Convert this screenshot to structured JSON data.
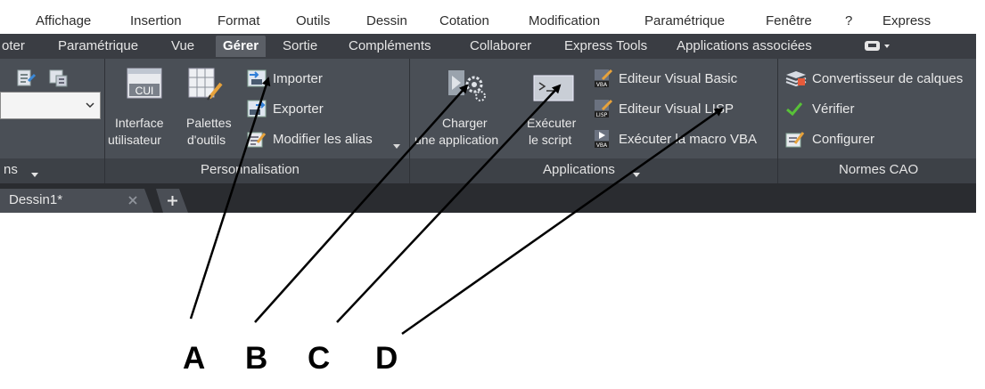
{
  "menubar": {
    "items": [
      "Affichage",
      "Insertion",
      "Format",
      "Outils",
      "Dessin",
      "Cotation",
      "Modification",
      "Paramétrique",
      "Fenêtre",
      "?",
      "Express"
    ]
  },
  "ribbon_tabs": {
    "items": [
      "oter",
      "Paramétrique",
      "Vue",
      "Gérer",
      "Sortie",
      "Compléments",
      "Collaborer",
      "Express Tools",
      "Applications associées"
    ],
    "active": "Gérer"
  },
  "customization": {
    "cui_icon_text": "CUI",
    "interface_line1": "Interface",
    "interface_line2": "utilisateur",
    "palettes_line1": "Palettes",
    "palettes_line2": "d'outils",
    "importer": "Importer",
    "exporter": "Exporter",
    "modifier_alias": "Modifier les alias",
    "panel_title": "Personnalisation",
    "left_panel_title": "ns"
  },
  "applications": {
    "charger_line1": "Charger",
    "charger_line2": "une application",
    "executer_line1": "Exécuter",
    "executer_line2": "le script",
    "vba_editor": "Editeur Visual Basic",
    "lisp_editor": "Editeur Visual LISP",
    "run_vba_macro": "Exécuter la macro VBA",
    "panel_title": "Applications",
    "vba_badge": "VBA",
    "lisp_badge": "LISP"
  },
  "standards": {
    "layer_converter": "Convertisseur de calques",
    "verify": "Vérifier",
    "configure": "Configurer",
    "panel_title": "Normes CAO"
  },
  "document_tabs": {
    "current": "Dessin1*"
  },
  "annotations": {
    "labels": [
      "A",
      "B",
      "C",
      "D"
    ]
  }
}
